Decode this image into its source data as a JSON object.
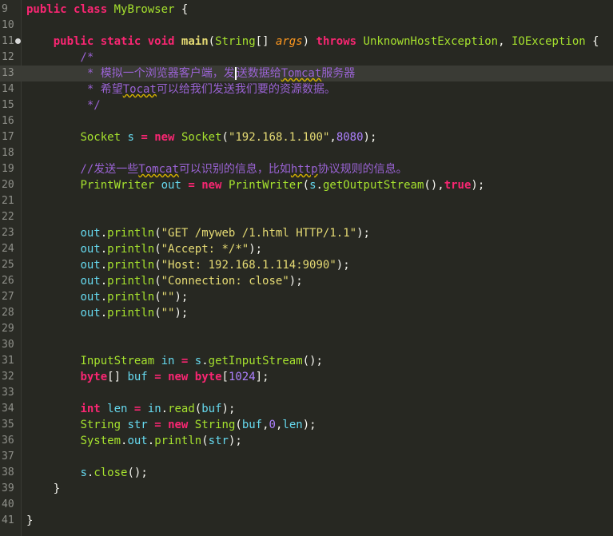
{
  "lines": [
    {
      "n": "9",
      "text": "public class MyBrowser {"
    },
    {
      "n": "10",
      "text": ""
    },
    {
      "n": "11",
      "text": "    public static void main(String[] args) throws UnknownHostException, IOException {"
    },
    {
      "n": "12",
      "text": "        /*"
    },
    {
      "n": "13",
      "text": "         * 模拟一个浏览器客户端，发送数据给Tomcat服务器"
    },
    {
      "n": "14",
      "text": "         * 希望Tocat可以给我们发送我们要的资源数据。"
    },
    {
      "n": "15",
      "text": "         */"
    },
    {
      "n": "16",
      "text": ""
    },
    {
      "n": "17",
      "text": "        Socket s = new Socket(\"192.168.1.100\",8080);"
    },
    {
      "n": "18",
      "text": ""
    },
    {
      "n": "19",
      "text": "        //发送一些Tomcat可以识别的信息，比如http协议规则的信息。"
    },
    {
      "n": "20",
      "text": "        PrintWriter out = new PrintWriter(s.getOutputStream(),true);"
    },
    {
      "n": "21",
      "text": ""
    },
    {
      "n": "22",
      "text": ""
    },
    {
      "n": "23",
      "text": "        out.println(\"GET /myweb /1.html HTTP/1.1\");"
    },
    {
      "n": "24",
      "text": "        out.println(\"Accept: */*\");"
    },
    {
      "n": "25",
      "text": "        out.println(\"Host: 192.168.1.114:9090\");"
    },
    {
      "n": "26",
      "text": "        out.println(\"Connection: close\");"
    },
    {
      "n": "27",
      "text": "        out.println(\"\");"
    },
    {
      "n": "28",
      "text": "        out.println(\"\");"
    },
    {
      "n": "29",
      "text": ""
    },
    {
      "n": "30",
      "text": ""
    },
    {
      "n": "31",
      "text": "        InputStream in = s.getInputStream();"
    },
    {
      "n": "32",
      "text": "        byte[] buf = new byte[1024];"
    },
    {
      "n": "33",
      "text": ""
    },
    {
      "n": "34",
      "text": "        int len = in.read(buf);"
    },
    {
      "n": "35",
      "text": "        String str = new String(buf,0,len);"
    },
    {
      "n": "36",
      "text": "        System.out.println(str);"
    },
    {
      "n": "37",
      "text": ""
    },
    {
      "n": "38",
      "text": "        s.close();"
    },
    {
      "n": "39",
      "text": "    }"
    },
    {
      "n": "40",
      "text": ""
    },
    {
      "n": "41",
      "text": "}"
    }
  ],
  "colors": {
    "background": "#272822",
    "keyword": "#f92672",
    "type": "#a6e22e",
    "string": "#e6db74",
    "number": "#ae81ff",
    "variable": "#66d9ef",
    "comment": "#9a63d4",
    "current_line": "#3a3b35"
  },
  "current_line": "13",
  "fold_marker_line": "11"
}
